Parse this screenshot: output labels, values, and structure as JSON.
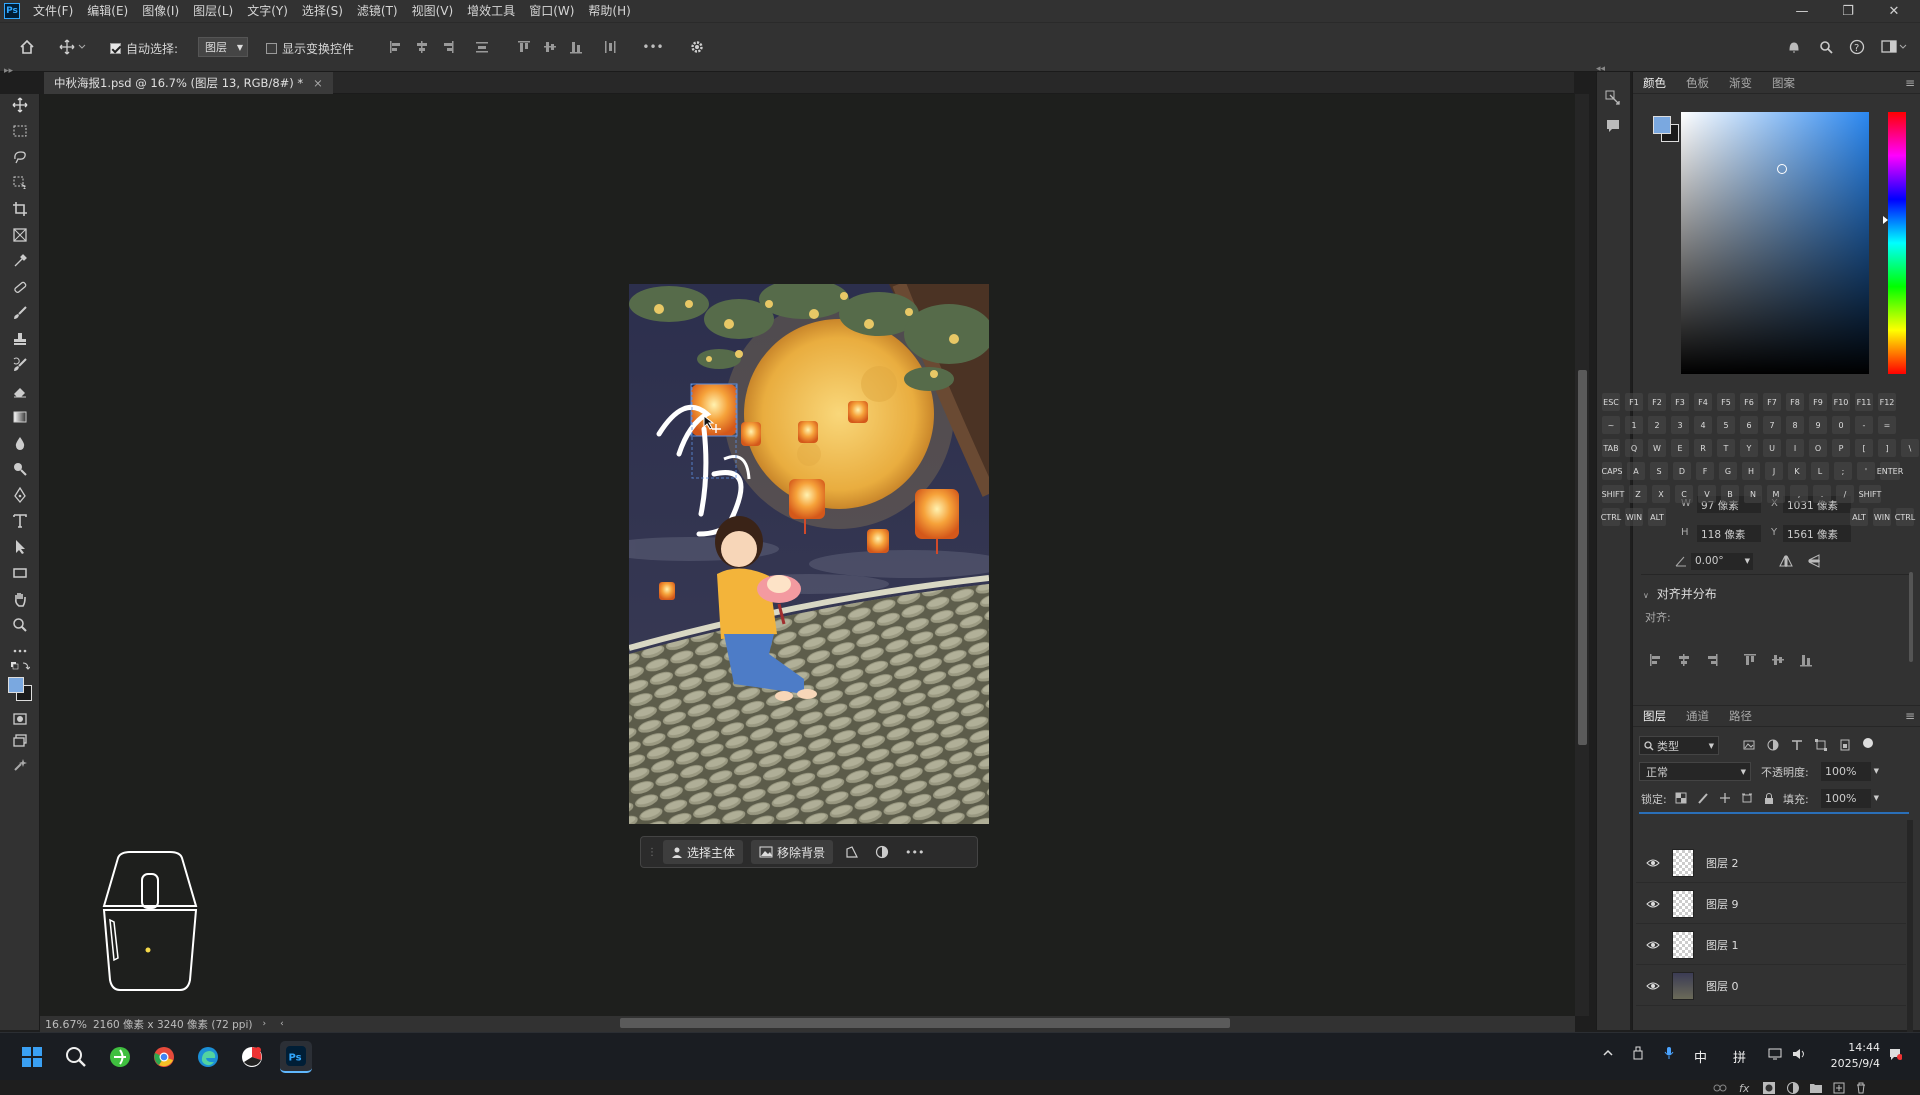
{
  "app": {
    "title": "Ps"
  },
  "menubar": {
    "items": [
      "文件(F)",
      "编辑(E)",
      "图像(I)",
      "图层(L)",
      "文字(Y)",
      "选择(S)",
      "滤镜(T)",
      "视图(V)",
      "增效工具",
      "窗口(W)",
      "帮助(H)"
    ],
    "minimize": "—",
    "restore": "❐",
    "close": "✕"
  },
  "options": {
    "auto_select_label": "自动选择:",
    "auto_select_value": "图层",
    "show_transform_label": "显示变换控件",
    "more": "•••"
  },
  "document": {
    "tab_title": "中秋海报1.psd @ 16.7% (图层 13, RGB/8#) *",
    "close": "×"
  },
  "context_bar": {
    "select_subject": "选择主体",
    "remove_bg": "移除背景",
    "more": "•••"
  },
  "status": {
    "zoom": "16.67%",
    "doc_info": "2160 像素 x 3240 像素 (72 ppi)"
  },
  "color_panel": {
    "tabs": [
      "颜色",
      "色板",
      "渐变",
      "图案"
    ],
    "fg_color": "#7aa8e0",
    "bg_color": "#1a1a1a"
  },
  "properties": {
    "w_label": "W",
    "w_value": "97 像素",
    "x_label": "X",
    "x_value": "1031 像素",
    "h_label": "H",
    "h_value": "118 像素",
    "y_label": "Y",
    "y_value": "1561 像素",
    "angle": "0.00°",
    "align_section": "对齐并分布",
    "align_label": "对齐:"
  },
  "keyboard": {
    "row1": [
      "ESC",
      "F1",
      "F2",
      "F3",
      "F4",
      "F5",
      "F6",
      "F7",
      "F8",
      "F9",
      "F10",
      "F11",
      "F12"
    ],
    "row2": [
      "~",
      "1",
      "2",
      "3",
      "4",
      "5",
      "6",
      "7",
      "8",
      "9",
      "0",
      "-",
      "="
    ],
    "row3": [
      "TAB",
      "Q",
      "W",
      "E",
      "R",
      "T",
      "Y",
      "U",
      "I",
      "O",
      "P",
      "[",
      "]",
      "\\"
    ],
    "row4": [
      "CAPS",
      "A",
      "S",
      "D",
      "F",
      "G",
      "H",
      "J",
      "K",
      "L",
      ";",
      "'",
      "ENTER"
    ],
    "row5": [
      "SHIFT",
      "Z",
      "X",
      "C",
      "V",
      "B",
      "N",
      "M",
      ",",
      ".",
      "/",
      "SHIFT"
    ],
    "row6": [
      "CTRL",
      "WIN",
      "ALT",
      "ALT",
      "WIN",
      "CTRL"
    ]
  },
  "layers_panel": {
    "tabs": [
      "图层",
      "通道",
      "路径"
    ],
    "filter_label": "类型",
    "blend_mode": "正常",
    "opacity_label": "不透明度:",
    "opacity_value": "100%",
    "lock_label": "锁定:",
    "fill_label": "填充:",
    "fill_value": "100%",
    "layers": [
      {
        "name": "图层 2"
      },
      {
        "name": "图层 9"
      },
      {
        "name": "图层 1"
      },
      {
        "name": "图层 0"
      }
    ]
  },
  "taskbar": {
    "clock_time": "14:44",
    "clock_date": "2025/9/4",
    "ime_lang": "中",
    "ime_mode": "拼"
  }
}
